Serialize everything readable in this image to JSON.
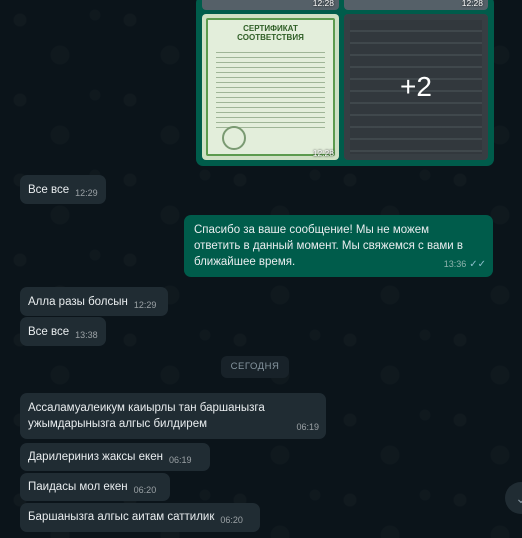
{
  "album": {
    "certificate_title": "СЕРТИФИКАТ\nСООТВЕТСТВИЯ",
    "thumb_times": [
      "12:28",
      "12:28",
      "12:28"
    ],
    "more_count": "+2"
  },
  "messages": [
    {
      "text": "Все все",
      "time": "12:29"
    },
    {
      "text_lines": [
        "Спасибо за ваше сообщение! Мы не можем",
        "ответить в данный момент. Мы свяжемся с вами в",
        "ближайшее время."
      ],
      "time": "13:36"
    },
    {
      "text": "Алла разы болсын",
      "time": "12:29"
    },
    {
      "text": "Все все",
      "time": "13:38"
    },
    {
      "text_lines": [
        "Ассаламуалеикум каиырлы тан баршанызга",
        "ужымдарынызга алгыс билдирем"
      ],
      "time": "06:19"
    },
    {
      "text": "Дарилериниз жаксы екен",
      "time": "06:19"
    },
    {
      "text": "Паидасы мол екен",
      "time": "06:20"
    },
    {
      "text": "Баршанызга алгыс аитам саттилик",
      "time": "06:20"
    }
  ],
  "date_divider": "СЕГОДНЯ",
  "icons": {
    "read_ticks": "double-check-icon",
    "scroll": "chevron-down-icon"
  }
}
